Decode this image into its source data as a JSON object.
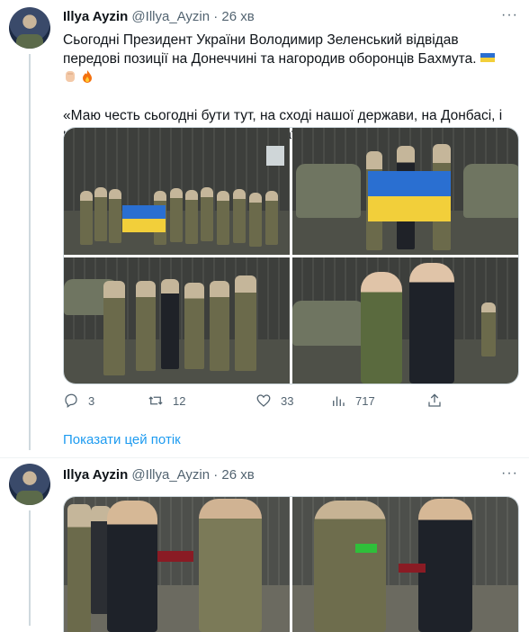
{
  "tweet1": {
    "author_name": "Illya Ayzin",
    "handle": "@Illya_Ayzin",
    "dot": "·",
    "time": "26 хв",
    "more": "···",
    "text_line1": "Сьогодні Президент України Володимир Зеленський відвідав передові позиції на Донеччині та нагородив оборонців Бахмута.",
    "text_line2": "«Маю честь сьогодні бути тут, на сході нашої держави, на Донбасі, і нагородити наших героїв, подякувати вам, потиснути руку.",
    "emojis": [
      "flag-ukraine-icon",
      "raised-fist-icon",
      "fire-icon"
    ],
    "actions": {
      "replies": "3",
      "retweets": "12",
      "likes": "33",
      "views": "717"
    }
  },
  "show_thread": "Показати цей потік",
  "tweet2": {
    "author_name": "Illya Ayzin",
    "handle": "@Illya_Ayzin",
    "dot": "·",
    "time": "26 хв",
    "more": "···"
  },
  "colors": {
    "link": "#1d9bf0",
    "secondary_text": "#536471",
    "flag_blue": "#2a6fd1",
    "flag_yellow": "#f2cf3a"
  }
}
